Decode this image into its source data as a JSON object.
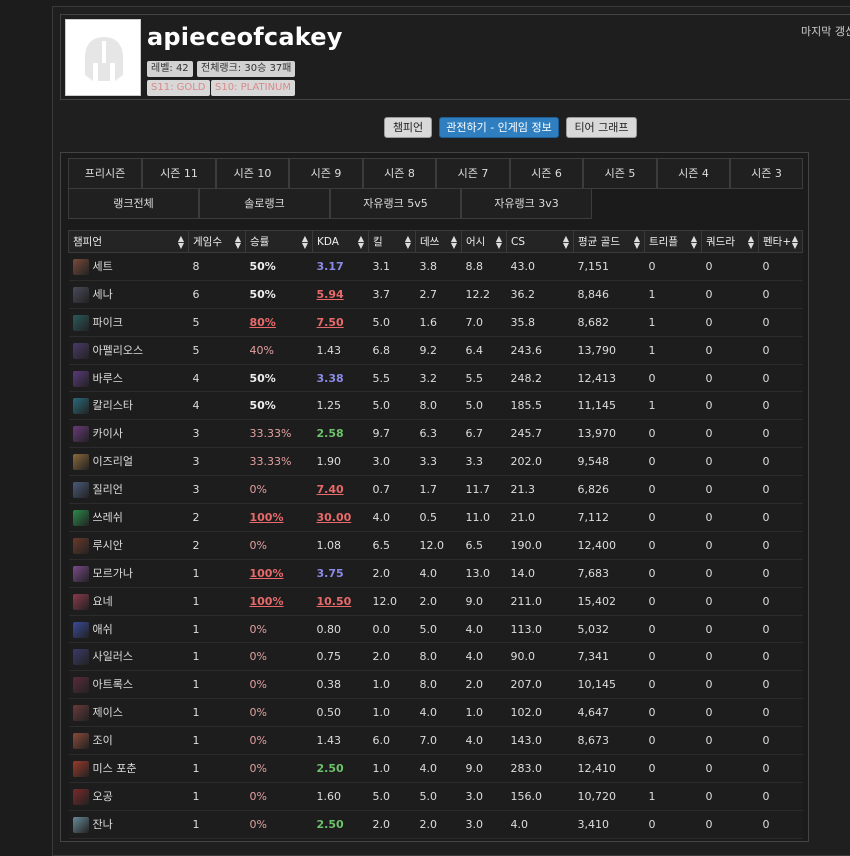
{
  "profile": {
    "summoner_name": "apieceofcakey",
    "level_badge": "레벨: 42",
    "overall_rank_badge": "전체랭크: 30승 37패",
    "tier_s11": "S11: GOLD",
    "tier_s10": "S10: PLATINUM",
    "last_update": "마지막 갱신"
  },
  "top_tabs": [
    {
      "label": "챔피언"
    },
    {
      "label": "관전하기 - 인게임 정보"
    },
    {
      "label": "티어 그래프"
    }
  ],
  "season_tabs": [
    {
      "label": "프리시즌"
    },
    {
      "label": "시즌 11"
    },
    {
      "label": "시즌 10"
    },
    {
      "label": "시즌 9"
    },
    {
      "label": "시즌 8"
    },
    {
      "label": "시즌 7"
    },
    {
      "label": "시즌 6"
    },
    {
      "label": "시즌 5"
    },
    {
      "label": "시즌 4"
    },
    {
      "label": "시즌 3"
    }
  ],
  "rank_tabs": [
    {
      "label": "랭크전체"
    },
    {
      "label": "솔로랭크"
    },
    {
      "label": "자유랭크 5v5"
    },
    {
      "label": "자유랭크 3v3"
    }
  ],
  "columns": [
    "챔피언",
    "게임수",
    "승률",
    "KDA",
    "킬",
    "데쓰",
    "어시",
    "CS",
    "평균 골드",
    "트리플",
    "쿼드라",
    "펜타+"
  ],
  "colors": {
    "accent": "#2f7fc0",
    "win_high": "#e86a6a",
    "kda_blue": "#8a8ae8",
    "kda_green": "#6bc26b"
  },
  "rows": [
    {
      "champ": "세트",
      "games": "8",
      "wr": "50%",
      "kda": "3.17",
      "k": "3.1",
      "d": "3.8",
      "a": "8.8",
      "cs": "43.0",
      "gold": "7,151",
      "triple": "0",
      "quadra": "0",
      "penta": "0",
      "icon_color": "#7a4a3a"
    },
    {
      "champ": "세나",
      "games": "6",
      "wr": "50%",
      "kda": "5.94",
      "k": "3.7",
      "d": "2.7",
      "a": "12.2",
      "cs": "36.2",
      "gold": "8,846",
      "triple": "1",
      "quadra": "0",
      "penta": "0",
      "icon_color": "#4a4a5a"
    },
    {
      "champ": "파이크",
      "games": "5",
      "wr": "80%",
      "kda": "7.50",
      "k": "5.0",
      "d": "1.6",
      "a": "7.0",
      "cs": "35.8",
      "gold": "8,682",
      "triple": "1",
      "quadra": "0",
      "penta": "0",
      "icon_color": "#2a5a5a"
    },
    {
      "champ": "아펠리오스",
      "games": "5",
      "wr": "40%",
      "kda": "1.43",
      "k": "6.8",
      "d": "9.2",
      "a": "6.4",
      "cs": "243.6",
      "gold": "13,790",
      "triple": "1",
      "quadra": "0",
      "penta": "0",
      "icon_color": "#4a3a6a"
    },
    {
      "champ": "바루스",
      "games": "4",
      "wr": "50%",
      "kda": "3.38",
      "k": "5.5",
      "d": "3.2",
      "a": "5.5",
      "cs": "248.2",
      "gold": "12,413",
      "triple": "0",
      "quadra": "0",
      "penta": "0",
      "icon_color": "#5a3a7a"
    },
    {
      "champ": "칼리스타",
      "games": "4",
      "wr": "50%",
      "kda": "1.25",
      "k": "5.0",
      "d": "8.0",
      "a": "5.0",
      "cs": "185.5",
      "gold": "11,145",
      "triple": "1",
      "quadra": "0",
      "penta": "0",
      "icon_color": "#2a6a7a"
    },
    {
      "champ": "카이사",
      "games": "3",
      "wr": "33.33%",
      "kda": "2.58",
      "k": "9.7",
      "d": "6.3",
      "a": "6.7",
      "cs": "245.7",
      "gold": "13,970",
      "triple": "0",
      "quadra": "0",
      "penta": "0",
      "icon_color": "#6a3a7a"
    },
    {
      "champ": "이즈리얼",
      "games": "3",
      "wr": "33.33%",
      "kda": "1.90",
      "k": "3.0",
      "d": "3.3",
      "a": "3.3",
      "cs": "202.0",
      "gold": "9,548",
      "triple": "0",
      "quadra": "0",
      "penta": "0",
      "icon_color": "#8a6a3a"
    },
    {
      "champ": "질리언",
      "games": "3",
      "wr": "0%",
      "kda": "7.40",
      "k": "0.7",
      "d": "1.7",
      "a": "11.7",
      "cs": "21.3",
      "gold": "6,826",
      "triple": "0",
      "quadra": "0",
      "penta": "0",
      "icon_color": "#4a5a7a"
    },
    {
      "champ": "쓰레쉬",
      "games": "2",
      "wr": "100%",
      "kda": "30.00",
      "k": "4.0",
      "d": "0.5",
      "a": "11.0",
      "cs": "21.0",
      "gold": "7,112",
      "triple": "0",
      "quadra": "0",
      "penta": "0",
      "icon_color": "#2a8a4a"
    },
    {
      "champ": "루시안",
      "games": "2",
      "wr": "0%",
      "kda": "1.08",
      "k": "6.5",
      "d": "12.0",
      "a": "6.5",
      "cs": "190.0",
      "gold": "12,400",
      "triple": "0",
      "quadra": "0",
      "penta": "0",
      "icon_color": "#6a3a2a"
    },
    {
      "champ": "모르가나",
      "games": "1",
      "wr": "100%",
      "kda": "3.75",
      "k": "2.0",
      "d": "4.0",
      "a": "13.0",
      "cs": "14.0",
      "gold": "7,683",
      "triple": "0",
      "quadra": "0",
      "penta": "0",
      "icon_color": "#7a4a8a"
    },
    {
      "champ": "요네",
      "games": "1",
      "wr": "100%",
      "kda": "10.50",
      "k": "12.0",
      "d": "2.0",
      "a": "9.0",
      "cs": "211.0",
      "gold": "15,402",
      "triple": "0",
      "quadra": "0",
      "penta": "0",
      "icon_color": "#8a3a4a"
    },
    {
      "champ": "애쉬",
      "games": "1",
      "wr": "0%",
      "kda": "0.80",
      "k": "0.0",
      "d": "5.0",
      "a": "4.0",
      "cs": "113.0",
      "gold": "5,032",
      "triple": "0",
      "quadra": "0",
      "penta": "0",
      "icon_color": "#3a4a9a"
    },
    {
      "champ": "사일러스",
      "games": "1",
      "wr": "0%",
      "kda": "0.75",
      "k": "2.0",
      "d": "8.0",
      "a": "4.0",
      "cs": "90.0",
      "gold": "7,341",
      "triple": "0",
      "quadra": "0",
      "penta": "0",
      "icon_color": "#3a3a6a"
    },
    {
      "champ": "아트록스",
      "games": "1",
      "wr": "0%",
      "kda": "0.38",
      "k": "1.0",
      "d": "8.0",
      "a": "2.0",
      "cs": "207.0",
      "gold": "10,145",
      "triple": "0",
      "quadra": "0",
      "penta": "0",
      "icon_color": "#5a2a3a"
    },
    {
      "champ": "제이스",
      "games": "1",
      "wr": "0%",
      "kda": "0.50",
      "k": "1.0",
      "d": "4.0",
      "a": "1.0",
      "cs": "102.0",
      "gold": "4,647",
      "triple": "0",
      "quadra": "0",
      "penta": "0",
      "icon_color": "#6a3a3a"
    },
    {
      "champ": "조이",
      "games": "1",
      "wr": "0%",
      "kda": "1.43",
      "k": "6.0",
      "d": "7.0",
      "a": "4.0",
      "cs": "143.0",
      "gold": "8,673",
      "triple": "0",
      "quadra": "0",
      "penta": "0",
      "icon_color": "#8a4a3a"
    },
    {
      "champ": "미스 포춘",
      "games": "1",
      "wr": "0%",
      "kda": "2.50",
      "k": "1.0",
      "d": "4.0",
      "a": "9.0",
      "cs": "283.0",
      "gold": "12,410",
      "triple": "0",
      "quadra": "0",
      "penta": "0",
      "icon_color": "#9a3a2a"
    },
    {
      "champ": "오공",
      "games": "1",
      "wr": "0%",
      "kda": "1.60",
      "k": "5.0",
      "d": "5.0",
      "a": "3.0",
      "cs": "156.0",
      "gold": "10,720",
      "triple": "1",
      "quadra": "0",
      "penta": "0",
      "icon_color": "#7a2a2a"
    },
    {
      "champ": "잔나",
      "games": "1",
      "wr": "0%",
      "kda": "2.50",
      "k": "2.0",
      "d": "2.0",
      "a": "3.0",
      "cs": "4.0",
      "gold": "3,410",
      "triple": "0",
      "quadra": "0",
      "penta": "0",
      "icon_color": "#6a8a9a"
    }
  ]
}
